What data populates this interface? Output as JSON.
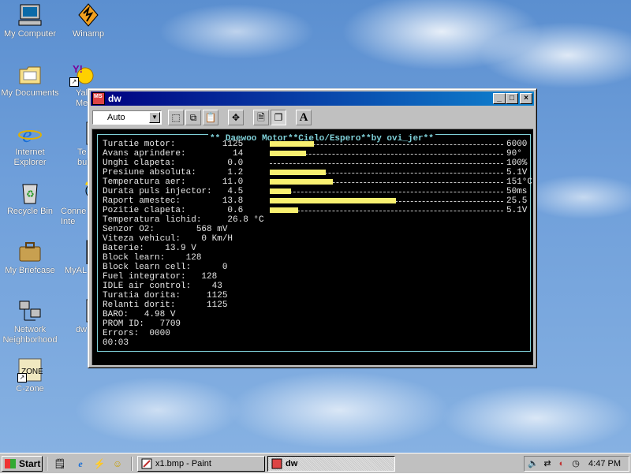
{
  "desktop": {
    "icons": [
      {
        "label": "My Computer"
      },
      {
        "label": "Winamp"
      },
      {
        "label": "My Documents"
      },
      {
        "label": "Yal\nMess"
      },
      {
        "label": "Internet\nExplorer"
      },
      {
        "label": "Te\nbuildi"
      },
      {
        "label": "Recycle Bin"
      },
      {
        "label": "Conne\nInte"
      },
      {
        "label": "My Briefcase"
      },
      {
        "label": "MyAL"
      },
      {
        "label": "Network\nNeighborhood"
      },
      {
        "label": "dw"
      },
      {
        "label": "C-zone"
      }
    ]
  },
  "window": {
    "title": "dw",
    "icon_text": "MS",
    "toolbar": {
      "font_combo_value": "Auto",
      "font_button_label": "A"
    },
    "header": "** Daewoo Motor**Cielo/Espero**by ovi_jer**",
    "rows": [
      "Turatie motor:         1125",
      "Avans aprindere:         14",
      "Unghi clapeta:          0.0",
      "Presiune absoluta:      1.2",
      "Temperatura aer:       11.0",
      "Durata puls injector:   4.5",
      "Raport amestec:        13.8",
      "Pozitie clapeta:        0.6",
      "Temperatura lichid:     26.8 °C",
      "Senzor O2:        568 mV",
      "Viteza vehicul:    0 Km/H",
      "Baterie:    13.9 V",
      "Block learn:    128",
      "Block learn cell:      0",
      "Fuel integrator:   128",
      "IDLE air control:    43",
      "Turatia dorita:     1125",
      "Relanti dorit:      1125",
      "BARO:   4.98 V",
      "PROM ID:   7709",
      "Errors:  0000",
      "00:03"
    ],
    "bars": [
      {
        "fraction": 0.1875,
        "max": "6000"
      },
      {
        "fraction": 0.156,
        "max": "90°"
      },
      {
        "fraction": 0.0,
        "max": "100%"
      },
      {
        "fraction": 0.24,
        "max": "5.1V"
      },
      {
        "fraction": 0.27,
        "max": "151°C"
      },
      {
        "fraction": 0.09,
        "max": "50ms"
      },
      {
        "fraction": 0.54,
        "max": "25.5"
      },
      {
        "fraction": 0.12,
        "max": "5.1V"
      }
    ]
  },
  "taskbar": {
    "start_label": "Start",
    "tasks": [
      {
        "label": "x1.bmp - Paint"
      },
      {
        "label": "dw"
      }
    ],
    "clock": "4:47 PM"
  },
  "colors": {
    "bar": "#f8f070",
    "frame": "#7fd0d8",
    "titlebar_start": "#000080",
    "titlebar_end": "#1084d0"
  }
}
